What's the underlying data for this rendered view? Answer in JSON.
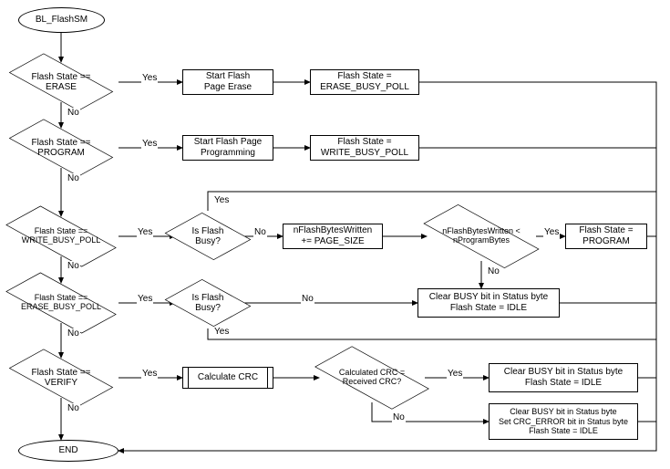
{
  "chart_data": {
    "type": "flowchart",
    "title": "BL_FlashSM",
    "start": "BL_FlashSM",
    "end": "END",
    "decisions": [
      {
        "id": "D1",
        "label": "Flash State == ERASE",
        "yes": "A1",
        "no": "D2"
      },
      {
        "id": "D2",
        "label": "Flash State == PROGRAM",
        "yes": "A3",
        "no": "D3"
      },
      {
        "id": "D3",
        "label": "Flash State == WRITE_BUSY_POLL",
        "yes": "D3b",
        "no": "D4"
      },
      {
        "id": "D3b",
        "label": "Is Flash Busy?",
        "yes": "END_merge",
        "no": "A5"
      },
      {
        "id": "D3c",
        "label": "nFlashBytesWritten < nProgramBytes",
        "yes": "A6",
        "no": "A7"
      },
      {
        "id": "D4",
        "label": "Flash State == ERASE_BUSY_POLL",
        "yes": "D4b",
        "no": "D5"
      },
      {
        "id": "D4b",
        "label": "Is Flash Busy?",
        "yes": "END_merge",
        "no": "A7"
      },
      {
        "id": "D5",
        "label": "Flash State == VERIFY",
        "yes": "A8",
        "no": "END"
      },
      {
        "id": "D5b",
        "label": "Calculated CRC = Received CRC?",
        "yes": "A9",
        "no": "A10"
      }
    ],
    "actions": [
      {
        "id": "A1",
        "label": "Start Flash Page Erase",
        "next": "A2"
      },
      {
        "id": "A2",
        "label": "Flash State = ERASE_BUSY_POLL",
        "next": "END_merge"
      },
      {
        "id": "A3",
        "label": "Start Flash Page Programming",
        "next": "A4"
      },
      {
        "id": "A4",
        "label": "Flash State = WRITE_BUSY_POLL",
        "next": "END_merge"
      },
      {
        "id": "A5",
        "label": "nFlashBytesWritten += PAGE_SIZE",
        "next": "D3c"
      },
      {
        "id": "A6",
        "label": "Flash State = PROGRAM",
        "next": "END_merge"
      },
      {
        "id": "A7",
        "label": "Clear BUSY bit in Status byte\nFlash State = IDLE",
        "next": "END_merge"
      },
      {
        "id": "A8",
        "label": "Calculate CRC",
        "type": "predefined",
        "next": "D5b"
      },
      {
        "id": "A9",
        "label": "Clear BUSY bit in Status byte\nFlash State = IDLE",
        "next": "END_merge"
      },
      {
        "id": "A10",
        "label": "Clear BUSY bit in Status byte\nSet CRC_ERROR bit in Status byte\nFlash State = IDLE",
        "next": "END_merge"
      }
    ]
  },
  "nodes": {
    "start": "BL_FlashSM",
    "end": "END",
    "d1": "Flash State ==\nERASE",
    "d2": "Flash State ==\nPROGRAM",
    "d3": "Flash State ==\nWRITE_BUSY_POLL",
    "d3b": "Is Flash\nBusy?",
    "d3c": "nFlashBytesWritten <\nnProgramBytes",
    "d4": "Flash State ==\nERASE_BUSY_POLL",
    "d4b": "Is Flash\nBusy?",
    "d5": "Flash State ==\nVERIFY",
    "d5b": "Calculated CRC =\nReceived CRC?",
    "a1": "Start Flash\nPage Erase",
    "a2": "Flash State =\nERASE_BUSY_POLL",
    "a3": "Start Flash Page\nProgramming",
    "a4": "Flash State =\nWRITE_BUSY_POLL",
    "a5": "nFlashBytesWritten\n+= PAGE_SIZE",
    "a6": "Flash State =\nPROGRAM",
    "a7": "Clear BUSY bit in Status byte\nFlash State = IDLE",
    "a8": "Calculate  CRC",
    "a9": "Clear BUSY bit in Status byte\nFlash State = IDLE",
    "a10": "Clear BUSY bit in Status byte\nSet CRC_ERROR bit in Status byte\nFlash State = IDLE"
  },
  "labels": {
    "yes": "Yes",
    "no": "No"
  }
}
